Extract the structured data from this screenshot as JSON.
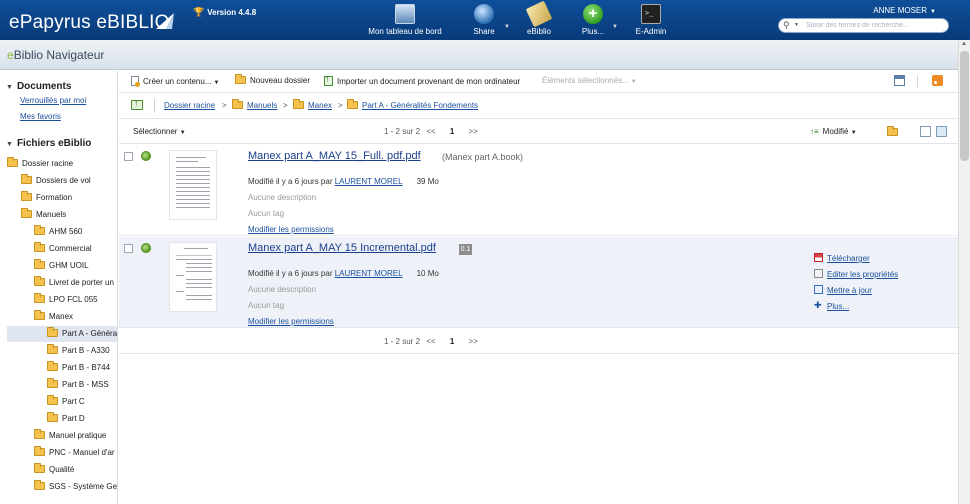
{
  "header": {
    "logo_brand": "ePapyrus",
    "logo_product": "eBIBLIO",
    "version": "Version 4.4.8",
    "nav": [
      {
        "label": "Mon tableau de bord",
        "icon": "monitor-icon"
      },
      {
        "label": "Share",
        "icon": "globe-icon"
      },
      {
        "label": "eBiblio",
        "icon": "book-icon"
      },
      {
        "label": "Plus...",
        "icon": "plus-circle-icon"
      },
      {
        "label": "E-Admin",
        "icon": "terminal-icon"
      }
    ],
    "user": "ANNE MOSER",
    "search_placeholder": "Saisir des termes de recherche..."
  },
  "titlebar": {
    "prefix": "e",
    "rest": "Biblio Navigateur"
  },
  "sidebar": {
    "documents_heading": "Documents",
    "documents_links": [
      "Verrouillés par moi",
      "Mes favoris"
    ],
    "files_heading": "Fichiers eBiblio",
    "tree": [
      "Dossier racine",
      "Dossiers de vol",
      "Formation",
      "Manuels",
      "AHM 560",
      "Commercial",
      "GHM UOIL",
      "Livret de porter un",
      "LPO FCL 055",
      "Manex",
      "Part A - Généra",
      "Part B - A330",
      "Part B - B744",
      "Part B - MSS",
      "Part C",
      "Part D",
      "Manuel pratique",
      "PNC - Manuel d'ar",
      "Qualité",
      "SGS - Système Ges"
    ]
  },
  "toolbar": {
    "create": "Créer un contenu...",
    "new_folder": "Nouveau dossier",
    "import": "Importer un document provenant de mon ordinateur",
    "selected": "Éléments sélectionnés..."
  },
  "breadcrumb": [
    "Dossier racine",
    "Manuels",
    "Manex",
    "Part A - Généralités Fondements"
  ],
  "listbar": {
    "select": "Sélectionner",
    "range": "1 - 2 sur 2",
    "prev": "<<",
    "page": "1",
    "next": ">>",
    "sort": "Modifié"
  },
  "documents": [
    {
      "name": "Manex part A_MAY 15_Full. pdf.pdf",
      "extra": "(Manex part A.book)",
      "modified_text": "Modifié il y a 6 jours par",
      "author": "LAURENT MOREL",
      "size": "39 Mo",
      "description": "Aucune description",
      "tags": "Aucun tag",
      "permissions": "Modifier les permissions"
    },
    {
      "name": "Manex part A_MAY 15 Incremental.pdf",
      "badge": "0.1",
      "modified_text": "Modifié il y a 6 jours par",
      "author": "LAURENT MOREL",
      "size": "10 Mo",
      "description": "Aucune description",
      "tags": "Aucun tag",
      "permissions": "Modifier les permissions",
      "actions": [
        "Télécharger",
        "Editer les propriétés",
        "Mettre à jour",
        "Plus..."
      ]
    }
  ]
}
